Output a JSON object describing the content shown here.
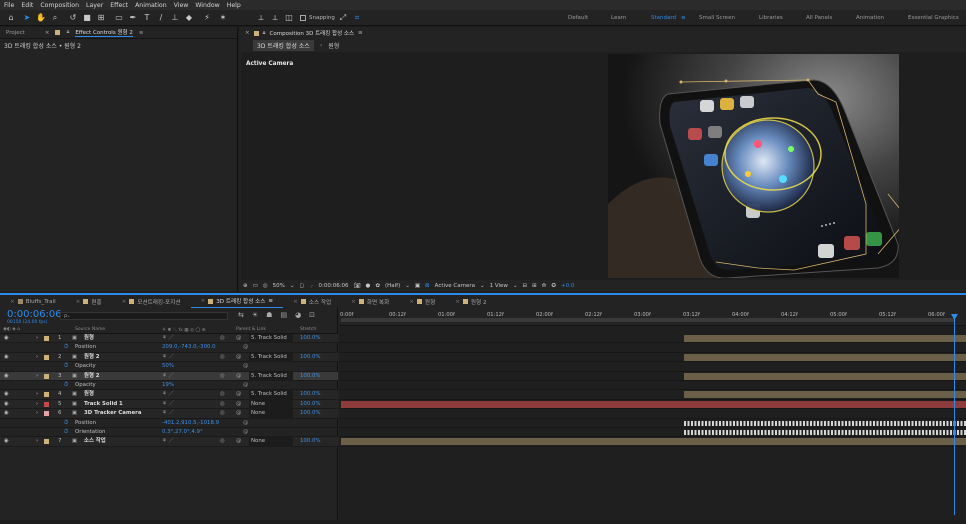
{
  "menu": [
    "File",
    "Edit",
    "Composition",
    "Layer",
    "Effect",
    "Animation",
    "View",
    "Window",
    "Help"
  ],
  "toolbar": {
    "snapping_label": "Snapping",
    "workspaces": [
      "Default",
      "Learn",
      "Standard",
      "Small Screen",
      "Libraries",
      "All Panels",
      "Animation",
      "Essential Graphics"
    ],
    "active_workspace": "Standard"
  },
  "left_panel": {
    "tabs": [
      "Project",
      "Effect Controls 원형 2"
    ],
    "breadcrumb": "3D 트래킹 합성 소스 • 원형 2"
  },
  "comp_panel": {
    "tab_label": "Composition 3D 트래킹 합성 소스",
    "sub_tabs": [
      "3D 트래킹 합성 소스",
      "원형"
    ],
    "active_camera_label": "Active Camera",
    "footer": {
      "zoom": "50%",
      "timecode": "0:00:06:06",
      "resolution": "(Half)",
      "camera": "Active Camera",
      "view": "1 View",
      "exposure": "+0.0"
    }
  },
  "timeline": {
    "tabs": [
      {
        "label": "Bluffs_Trail",
        "color": "#9b8a6a"
      },
      {
        "label": "편흥",
        "color": "#cdb37a"
      },
      {
        "label": "모션트래킹-포지션",
        "color": "#cdb37a"
      },
      {
        "label": "3D 트래킹 합성 소스",
        "color": "#cdb37a"
      },
      {
        "label": "소스 작업",
        "color": "#cdb37a"
      },
      {
        "label": "화면 복화",
        "color": "#cdb37a"
      },
      {
        "label": "원형",
        "color": "#cdb37a"
      },
      {
        "label": "원형 2",
        "color": "#cdb37a"
      }
    ],
    "current_time": "0:00:06:06",
    "frame_info": "00150 (24.00 fps)",
    "search_placeholder": "ρ₊",
    "col_headers": {
      "source_name": "Source Name",
      "parent": "Parent & Link",
      "stretch": "Stretch"
    },
    "ruler": [
      "0:00f",
      "00:12f",
      "01:00f",
      "01:12f",
      "02:00f",
      "02:12f",
      "03:00f",
      "03:12f",
      "04:00f",
      "04:12f",
      "05:00f",
      "05:12f",
      "06:00f"
    ],
    "layers": [
      {
        "type": "layer",
        "num": "1",
        "name": "원형",
        "parent": "5. Track Solid",
        "stretch": "100.0%",
        "color": "#cdb37a"
      },
      {
        "type": "prop",
        "name": "Position",
        "value": "209.0,-743.0,-300.0"
      },
      {
        "type": "layer",
        "num": "2",
        "name": "원형 2",
        "parent": "5. Track Solid",
        "stretch": "100.0%",
        "color": "#cdb37a"
      },
      {
        "type": "prop",
        "name": "Opacity",
        "value": "50%"
      },
      {
        "type": "layer",
        "num": "3",
        "name": "원형 2",
        "parent": "5. Track Solid",
        "stretch": "100.0%",
        "color": "#cdb37a",
        "selected": true
      },
      {
        "type": "prop",
        "name": "Opacity",
        "value": "19%"
      },
      {
        "type": "layer",
        "num": "4",
        "name": "원형",
        "parent": "5. Track Solid",
        "stretch": "100.0%",
        "color": "#cdb37a"
      },
      {
        "type": "layer",
        "num": "5",
        "name": "Track Solid 1",
        "parent": "None",
        "stretch": "100.0%",
        "color": "#c44a4a"
      },
      {
        "type": "layer",
        "num": "6",
        "name": "3D Tracker Camera",
        "parent": "None",
        "stretch": "100.0%",
        "color": "#e8a0a0"
      },
      {
        "type": "prop",
        "name": "Position",
        "value": "-401.2,910.5,-1018.9"
      },
      {
        "type": "prop",
        "name": "Orientation",
        "value": "0.3°,27.0°,4.9°"
      },
      {
        "type": "layer",
        "num": "7",
        "name": "소스 작업",
        "parent": "None",
        "stretch": "100.0%",
        "color": "#cdb37a"
      }
    ]
  }
}
